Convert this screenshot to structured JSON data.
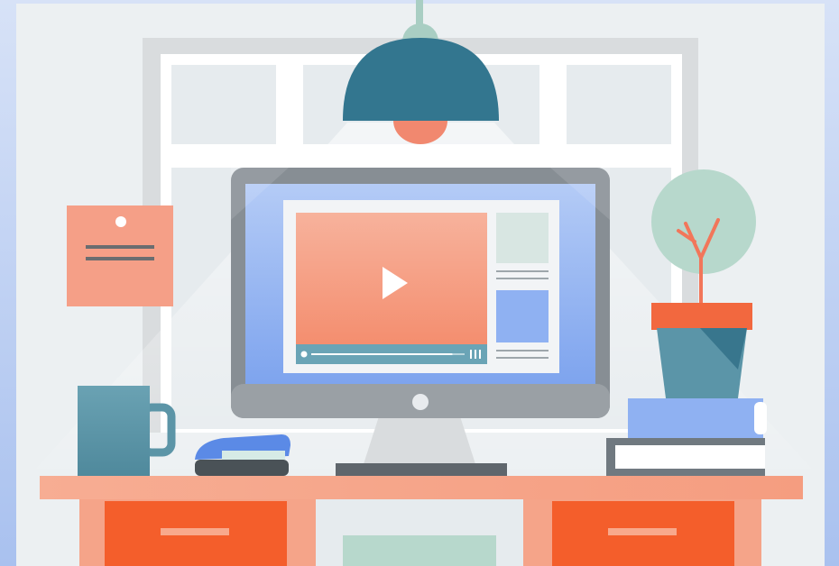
{
  "scene": {
    "subject": "desk-workspace-illustration",
    "video_player": {
      "icon": "play-icon",
      "progress": 0.92
    },
    "colors": {
      "frame_gradient_top": "#d7e2f7",
      "frame_gradient_bottom": "#a9c1ef",
      "wall": "#ecf0f2",
      "window_frame": "#d9dcde",
      "window_pane": "#e6ebee",
      "lamp_shade": "#33768f",
      "lamp_bulb": "#f1886f",
      "lamp_cap": "#a9cec3",
      "monitor_bezel": "#878e94",
      "monitor_screen": "#8fb1f2",
      "video_panel": "#f59f87",
      "video_controls": "#6aa4b6",
      "note_paper": "#f59f87",
      "mug": "#5c95a7",
      "stapler_top": "#5b8ae6",
      "plant_foliage": "#b7d8cc",
      "plant_stem": "#f2765a",
      "pot_rim": "#f2683f",
      "pot_body": "#5b95a8",
      "book_blue": "#8fb1f2",
      "book_gray": "#707980",
      "desk_top": "#f5a489",
      "desk_drawer": "#f45e2b",
      "desk_center_panel": "#e6ebee",
      "desk_center_slot": "#b7d8cc"
    }
  }
}
